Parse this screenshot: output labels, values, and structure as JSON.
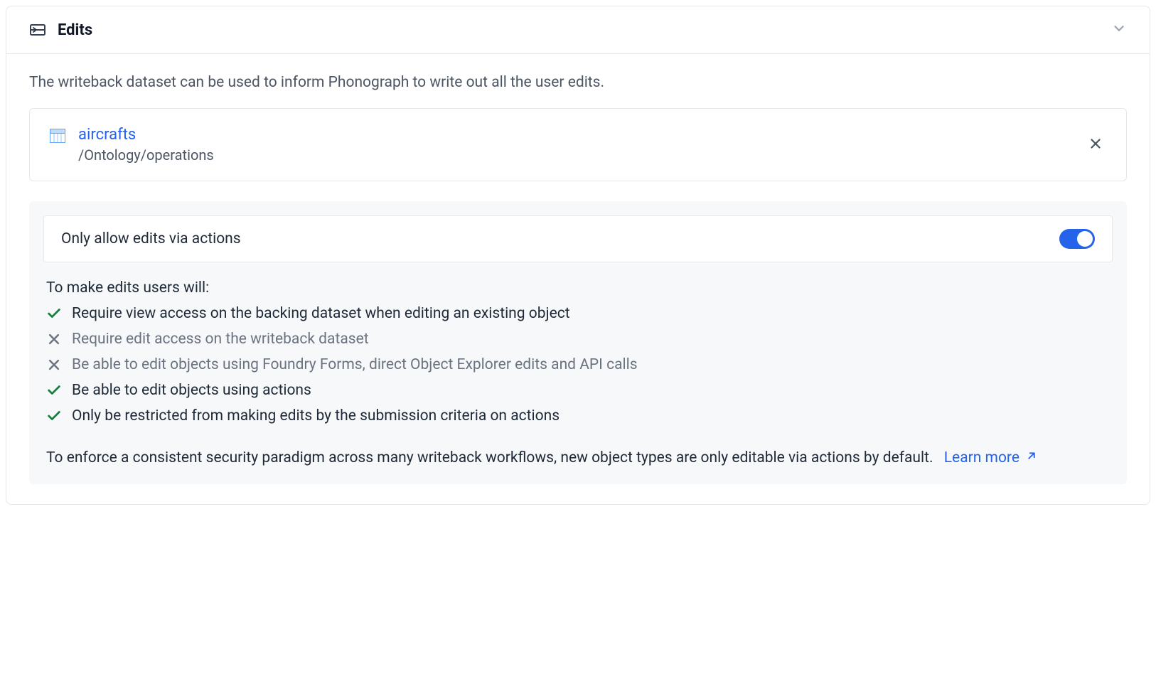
{
  "header": {
    "title": "Edits"
  },
  "description": "The writeback dataset can be used to inform Phonograph to write out all the user edits.",
  "dataset": {
    "name": "aircrafts",
    "path": "/Ontology/operations"
  },
  "toggle": {
    "label": "Only allow edits via actions",
    "enabled": true
  },
  "rules": {
    "intro": "To make edits users will:",
    "items": [
      {
        "enabled": true,
        "text": "Require view access on the backing dataset when editing an existing object"
      },
      {
        "enabled": false,
        "text": "Require edit access on the writeback dataset"
      },
      {
        "enabled": false,
        "text": "Be able to edit objects using Foundry Forms, direct Object Explorer edits and API calls"
      },
      {
        "enabled": true,
        "text": "Be able to edit objects using actions"
      },
      {
        "enabled": true,
        "text": "Only be restricted from making edits by the submission criteria on actions"
      }
    ]
  },
  "footer": {
    "note": "To enforce a consistent security paradigm across many writeback workflows, new object types are only editable via actions by default.",
    "learn_more": "Learn more"
  }
}
